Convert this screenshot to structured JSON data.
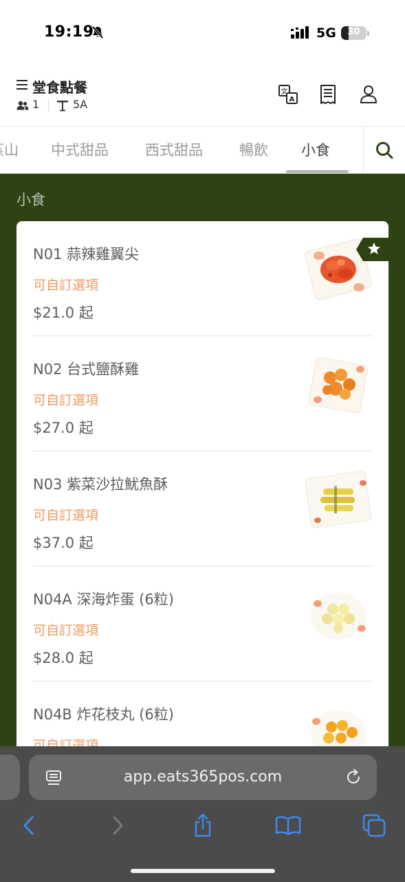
{
  "status_bar": {
    "time": "19:19",
    "network": "5G",
    "battery_level": "30",
    "battery_fraction": 0.3,
    "silent_icon": "bell-slash-icon",
    "signal_icon": "cellular-signal-icon"
  },
  "header": {
    "title": "堂食點餐",
    "guests": "1",
    "table": "5A",
    "icons": [
      "menu-icon",
      "guests-icon",
      "table-icon",
      "translate-icon",
      "receipt-icon",
      "account-icon"
    ]
  },
  "tabs": {
    "items": [
      {
        "label": "蒸山"
      },
      {
        "label": "中式甜品"
      },
      {
        "label": "西式甜品"
      },
      {
        "label": "暢飲"
      },
      {
        "label": "小食"
      }
    ],
    "active": "小食",
    "search_icon": "search-icon"
  },
  "section": {
    "title": "小食"
  },
  "menu_items": [
    {
      "name": "N01 蒜辣雞翼尖",
      "option": "可自訂選項",
      "price": "$21.0 起",
      "favorite": true,
      "dish": "garlic-chili-chicken-wing-tips"
    },
    {
      "name": "N02 台式鹽酥雞",
      "option": "可自訂選項",
      "price": "$27.0 起",
      "favorite": false,
      "dish": "taiwanese-popcorn-chicken"
    },
    {
      "name": "N03 紫菜沙拉魷魚酥",
      "option": "可自訂選項",
      "price": "$37.0 起",
      "favorite": false,
      "dish": "seaweed-salad-squid-rolls"
    },
    {
      "name": "N04A 深海炸蛋 (6粒)",
      "option": "可自訂選項",
      "price": "$28.0 起",
      "favorite": false,
      "dish": "fried-fish-balls"
    },
    {
      "name": "N04B 炸花枝丸 (6粒)",
      "option": "可自訂選項",
      "price": "",
      "favorite": false,
      "dish": "fried-cuttlefish-balls"
    }
  ],
  "browser": {
    "url": "app.eats365pos.com",
    "accent": "#3d8bf2",
    "icons": [
      "reader-icon",
      "reload-icon",
      "back-icon",
      "forward-icon",
      "share-icon",
      "bookmarks-icon",
      "tabs-icon"
    ]
  },
  "colors": {
    "section_bg": "#2d4314",
    "option_text": "#ee9a63",
    "favorite_badge": "#2d4314"
  }
}
